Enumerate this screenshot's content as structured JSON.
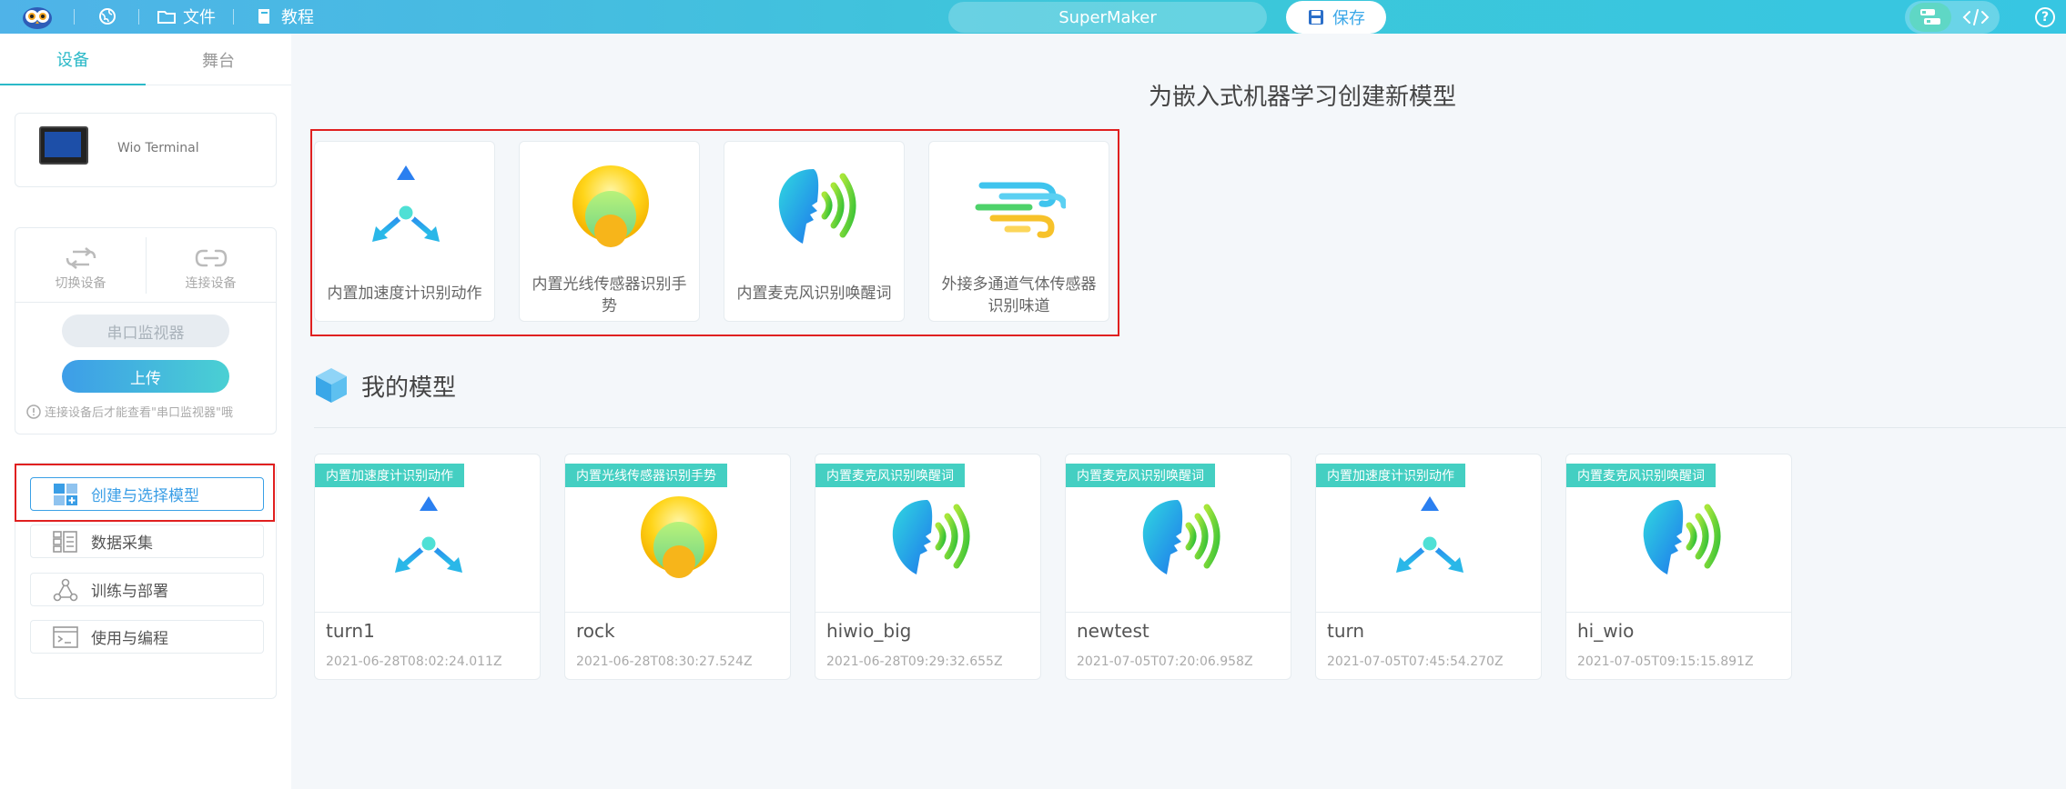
{
  "topbar": {
    "file_label": "文件",
    "tutorial_label": "教程",
    "project_name": "SuperMaker",
    "save_label": "保存",
    "help_char": "?"
  },
  "sidebar": {
    "tabs": [
      {
        "label": "设备",
        "active": true
      },
      {
        "label": "舞台",
        "active": false
      }
    ],
    "device_name": "Wio Terminal",
    "switch_device": "切换设备",
    "connect_device": "连接设备",
    "serial_monitor": "串口监视器",
    "upload": "上传",
    "hint": "连接设备后才能查看\"串口监视器\"哦",
    "steps": [
      {
        "label": "创建与选择模型",
        "active": true,
        "icon": "grid-plus-icon"
      },
      {
        "label": "数据采集",
        "active": false,
        "icon": "data-list-icon"
      },
      {
        "label": "训练与部署",
        "active": false,
        "icon": "network-nodes-icon"
      },
      {
        "label": "使用与编程",
        "active": false,
        "icon": "code-window-icon"
      }
    ]
  },
  "main": {
    "title": "为嵌入式机器学习创建新模型",
    "templates": [
      {
        "label": "内置加速度计识别动作",
        "icon": "accelerometer-icon"
      },
      {
        "label": "内置光线传感器识别手势",
        "icon": "light-sensor-icon"
      },
      {
        "label": "内置麦克风识别唤醒词",
        "icon": "microphone-voice-icon"
      },
      {
        "label": "外接多通道气体传感器识别味道",
        "icon": "gas-wind-icon"
      }
    ],
    "my_models_title": "我的模型",
    "models": [
      {
        "tag": "内置加速度计识别动作",
        "name": "turn1",
        "date": "2021-06-28T08:02:24.011Z",
        "icon": "accelerometer-icon"
      },
      {
        "tag": "内置光线传感器识别手势",
        "name": "rock",
        "date": "2021-06-28T08:30:27.524Z",
        "icon": "light-sensor-icon"
      },
      {
        "tag": "内置麦克风识别唤醒词",
        "name": "hiwio_big",
        "date": "2021-06-28T09:29:32.655Z",
        "icon": "microphone-voice-icon"
      },
      {
        "tag": "内置麦克风识别唤醒词",
        "name": "newtest",
        "date": "2021-07-05T07:20:06.958Z",
        "icon": "microphone-voice-icon"
      },
      {
        "tag": "内置加速度计识别动作",
        "name": "turn",
        "date": "2021-07-05T07:45:54.270Z",
        "icon": "accelerometer-icon"
      },
      {
        "tag": "内置麦克风识别唤醒词",
        "name": "hi_wio",
        "date": "2021-07-05T09:15:15.891Z",
        "icon": "microphone-voice-icon"
      }
    ]
  },
  "colors": {
    "accent": "#2bb9c8",
    "highlight_border": "#e02020",
    "tag_bg": "#44cfc2"
  }
}
